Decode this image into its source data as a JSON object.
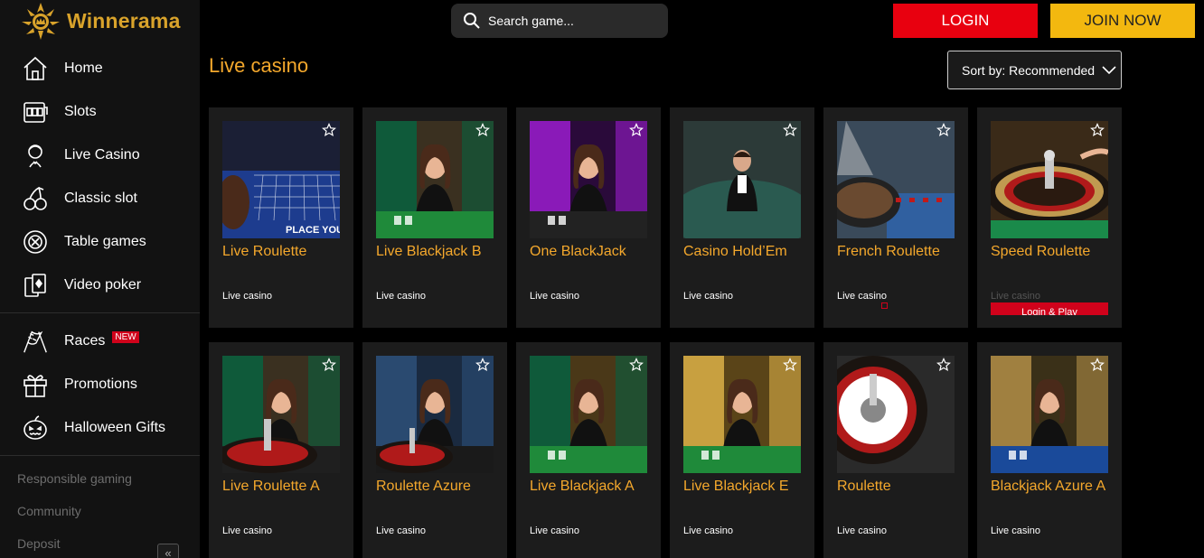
{
  "brand": {
    "name": "Winnerama",
    "accent": "#d9a32b"
  },
  "header": {
    "search_placeholder": "Search game...",
    "login_label": "LOGIN",
    "join_label": "JOIN NOW"
  },
  "sidebar": {
    "items": [
      {
        "label": "Home",
        "icon": "home-icon"
      },
      {
        "label": "Slots",
        "icon": "slot-machine-icon"
      },
      {
        "label": "Live Casino",
        "icon": "dealer-icon"
      },
      {
        "label": "Classic slot",
        "icon": "cherries-icon"
      },
      {
        "label": "Table games",
        "icon": "chip-icon"
      },
      {
        "label": "Video poker",
        "icon": "cards-icon"
      }
    ],
    "extras": [
      {
        "label": "Races",
        "icon": "race-flags-icon",
        "badge": "NEW"
      },
      {
        "label": "Promotions",
        "icon": "gift-icon"
      },
      {
        "label": "Halloween Gifts",
        "icon": "pumpkin-icon"
      }
    ],
    "footer": [
      "Responsible gaming",
      "Community",
      "Deposit"
    ],
    "collapse_label": "«"
  },
  "main": {
    "title": "Live casino",
    "sort_label": "Sort by: Recommended",
    "hover_button_label": "Login & Play",
    "games": [
      {
        "name": "Live Roulette",
        "category": "Live casino",
        "art": "table"
      },
      {
        "name": "Live Blackjack B",
        "category": "Live casino",
        "art": "dealer-green"
      },
      {
        "name": "One BlackJack",
        "category": "Live casino",
        "art": "dealer-purple"
      },
      {
        "name": "Casino Hold’Em",
        "category": "Live casino",
        "art": "dealer-teal"
      },
      {
        "name": "French Roulette",
        "category": "Live casino",
        "art": "wheel-blue"
      },
      {
        "name": "Speed Roulette",
        "category": "Live casino",
        "art": "wheel-gold"
      },
      {
        "name": "Live Roulette A",
        "category": "Live casino",
        "art": "dealer-green-wheel"
      },
      {
        "name": "Roulette Azure",
        "category": "Live casino",
        "art": "dealer-blue-wheel"
      },
      {
        "name": "Live Blackjack A",
        "category": "Live casino",
        "art": "dealer-gold"
      },
      {
        "name": "Live Blackjack E",
        "category": "Live casino",
        "art": "dealer-gold2"
      },
      {
        "name": "Roulette",
        "category": "Live casino",
        "art": "wheel-close"
      },
      {
        "name": "Blackjack Azure A",
        "category": "Live casino",
        "art": "dealer-blue"
      }
    ]
  },
  "colors": {
    "title": "#f4a82c",
    "login": "#e8000f",
    "join": "#f3b80f"
  }
}
